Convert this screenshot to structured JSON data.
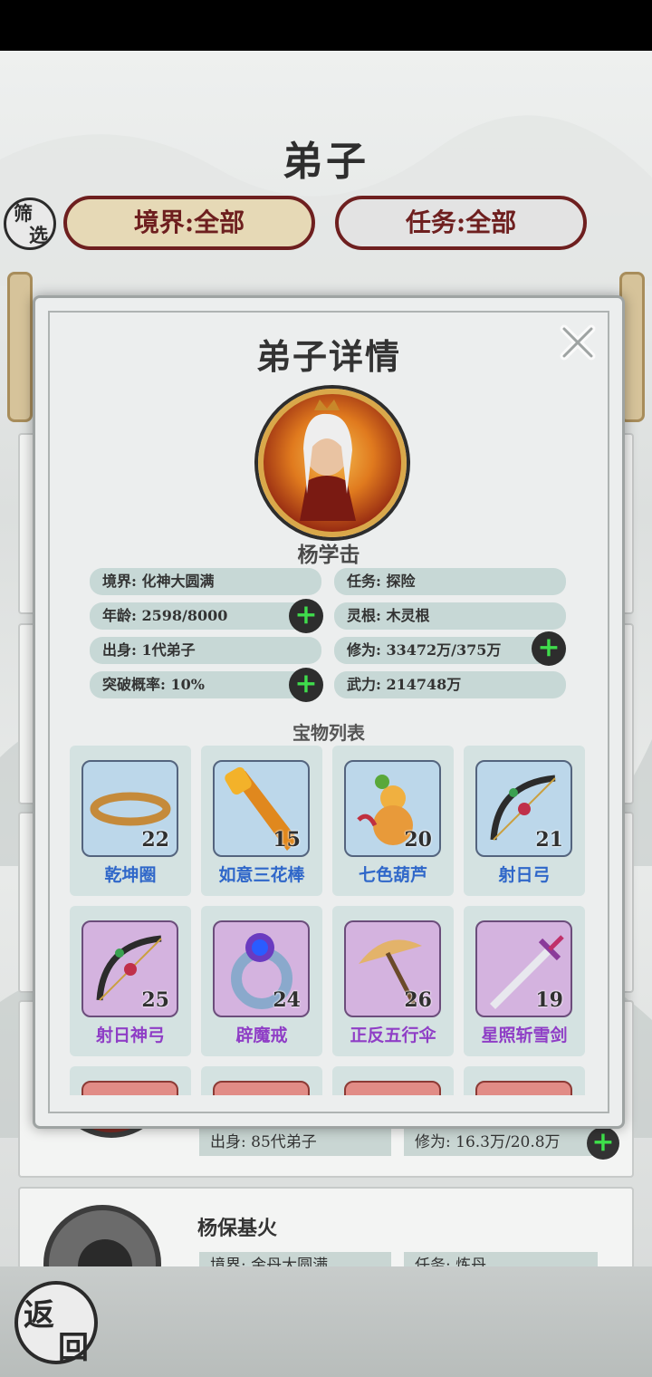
{
  "header": {
    "title": "弟子"
  },
  "filters": {
    "icon_text": [
      "筛",
      "选"
    ],
    "realm": "境界:全部",
    "task": "任务:全部"
  },
  "background_list": {
    "card_a": {
      "origin": "出身: 85代弟子",
      "cultivation": "修为: 16.3万/20.8万"
    },
    "card_b": {
      "name": "杨保基火",
      "realm": "境界: 金丹大圆满",
      "task": "任务: 炼丹"
    }
  },
  "back_button": {
    "chars": [
      "返",
      "回"
    ]
  },
  "modal": {
    "title": "弟子详情",
    "name": "杨学击",
    "stats": {
      "realm": "境界: 化神大圆满",
      "task": "任务: 探险",
      "age": "年龄: 2598/8000",
      "spirit_root": "灵根: 木灵根",
      "origin": "出身: 1代弟子",
      "cultivation": "修为: 33472万/375万",
      "breakthrough": "突破概率: 10%",
      "power": "武力: 214748万"
    },
    "plus_symbol": "+",
    "treasure_title": "宝物列表",
    "treasures": [
      {
        "name": "乾坤圈",
        "level": "22",
        "rarity": "blue"
      },
      {
        "name": "如意三花棒",
        "level": "15",
        "rarity": "blue"
      },
      {
        "name": "七色葫芦",
        "level": "20",
        "rarity": "blue"
      },
      {
        "name": "射日弓",
        "level": "21",
        "rarity": "blue"
      },
      {
        "name": "射日神弓",
        "level": "25",
        "rarity": "purple"
      },
      {
        "name": "辟魔戒",
        "level": "24",
        "rarity": "purple"
      },
      {
        "name": "正反五行伞",
        "level": "26",
        "rarity": "purple"
      },
      {
        "name": "星照斩雪剑",
        "level": "19",
        "rarity": "purple"
      }
    ]
  },
  "colors": {
    "accent_dark": "#6e1f1f",
    "blue_rarity": "#2f67c9",
    "purple_rarity": "#8f3ec6",
    "plus_green": "#3fdc4c"
  }
}
